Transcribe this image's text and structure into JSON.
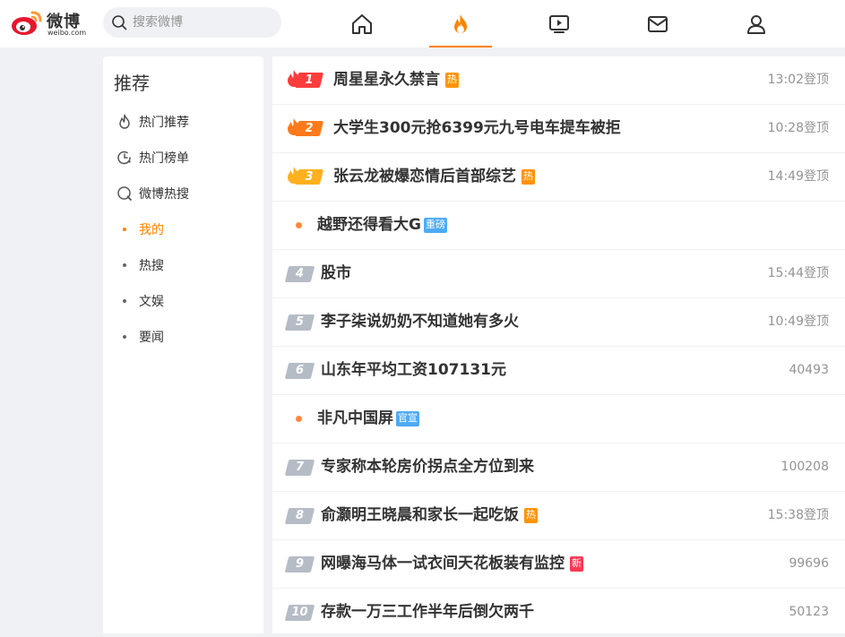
{
  "header": {
    "logo_brand": "微博",
    "logo_domain": "weibo.com",
    "search_placeholder": "搜索微博",
    "nav": [
      {
        "icon": "home-icon"
      },
      {
        "icon": "hot-fire-icon",
        "active": true
      },
      {
        "icon": "video-icon"
      },
      {
        "icon": "mail-icon"
      },
      {
        "icon": "user-icon"
      }
    ],
    "accent": "#ff8200"
  },
  "sidebar": {
    "title": "推荐",
    "items": [
      {
        "label": "热门推荐",
        "icon": "flame-outline-icon"
      },
      {
        "label": "热门榜单",
        "icon": "clock-list-icon"
      },
      {
        "label": "微博热搜",
        "icon": "search-circle-icon"
      },
      {
        "label": "我的",
        "active": true
      },
      {
        "label": "热搜"
      },
      {
        "label": "文娱"
      },
      {
        "label": "要闻"
      }
    ]
  },
  "hotlist": [
    {
      "rank": "1",
      "title": "周星星永久禁言",
      "badge": "热",
      "meta": "13:02登顶"
    },
    {
      "rank": "2",
      "title": "大学生300元抢6399元九号电车提车被拒",
      "badge": "",
      "meta": "10:28登顶"
    },
    {
      "rank": "3",
      "title": "张云龙被爆恋情后首部综艺",
      "badge": "热",
      "meta": "14:49登顶"
    },
    {
      "rank": "",
      "title": "越野还得看大G",
      "badge": "重磅",
      "meta": ""
    },
    {
      "rank": "4",
      "title": "股市",
      "badge": "",
      "meta": "15:44登顶"
    },
    {
      "rank": "5",
      "title": "李子柒说奶奶不知道她有多火",
      "badge": "",
      "meta": "10:49登顶"
    },
    {
      "rank": "6",
      "title": "山东年平均工资107131元",
      "badge": "",
      "meta": "40493"
    },
    {
      "rank": "",
      "title": "非凡中国屏",
      "badge": "官宣",
      "meta": ""
    },
    {
      "rank": "7",
      "title": "专家称本轮房价拐点全方位到来",
      "badge": "",
      "meta": "100208"
    },
    {
      "rank": "8",
      "title": "俞灏明王晓晨和家长一起吃饭",
      "badge": "热",
      "meta": "15:38登顶"
    },
    {
      "rank": "9",
      "title": "网曝海马体一试衣间天花板装有监控",
      "badge": "新",
      "meta": "99696"
    },
    {
      "rank": "10",
      "title": "存款一万三工作半年后倒欠两千",
      "badge": "",
      "meta": "50123"
    }
  ],
  "colors": {
    "rank1": "#ff3d3d",
    "rank2": "#ff7a1a",
    "rank3": "#ffb01f",
    "rank_other": "#b6bcc6",
    "badge_hot": "#ff9406",
    "badge_new": "#ff3852",
    "badge_promo": "#4dabf7"
  }
}
